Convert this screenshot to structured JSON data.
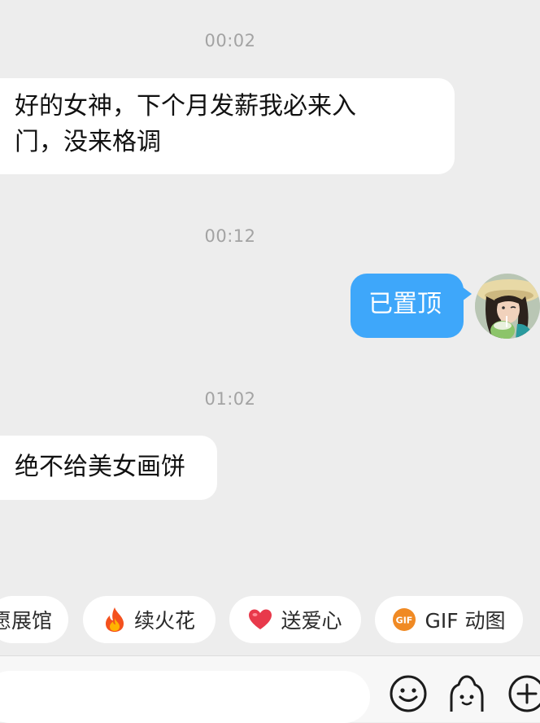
{
  "messages": [
    {
      "type": "timestamp",
      "text": "00:02"
    },
    {
      "type": "incoming",
      "text_line1": "好的女神，下个月发薪我必来入",
      "text_line2": "门，没来格调"
    },
    {
      "type": "timestamp",
      "text": "00:12"
    },
    {
      "type": "outgoing",
      "text": "已置顶"
    },
    {
      "type": "timestamp",
      "text": "01:02"
    },
    {
      "type": "incoming",
      "text": "绝不给美女画饼"
    }
  ],
  "quick_actions": [
    {
      "label": "愿展馆",
      "icon": "none"
    },
    {
      "label": "续火花",
      "icon": "fire-icon"
    },
    {
      "label": "送爱心",
      "icon": "heart-icon"
    },
    {
      "label": "GIF 动图",
      "icon": "gif-icon",
      "icon_text": "GIF"
    }
  ],
  "input_bar": {
    "placeholder": "",
    "icons": [
      "emoji-icon",
      "sticker-icon",
      "plus-icon"
    ]
  },
  "colors": {
    "background": "#ededed",
    "outgoing_bubble": "#3ea7fa",
    "incoming_bubble": "#ffffff",
    "timestamp": "#a3a3a3",
    "gif_badge": "#f08a24"
  }
}
